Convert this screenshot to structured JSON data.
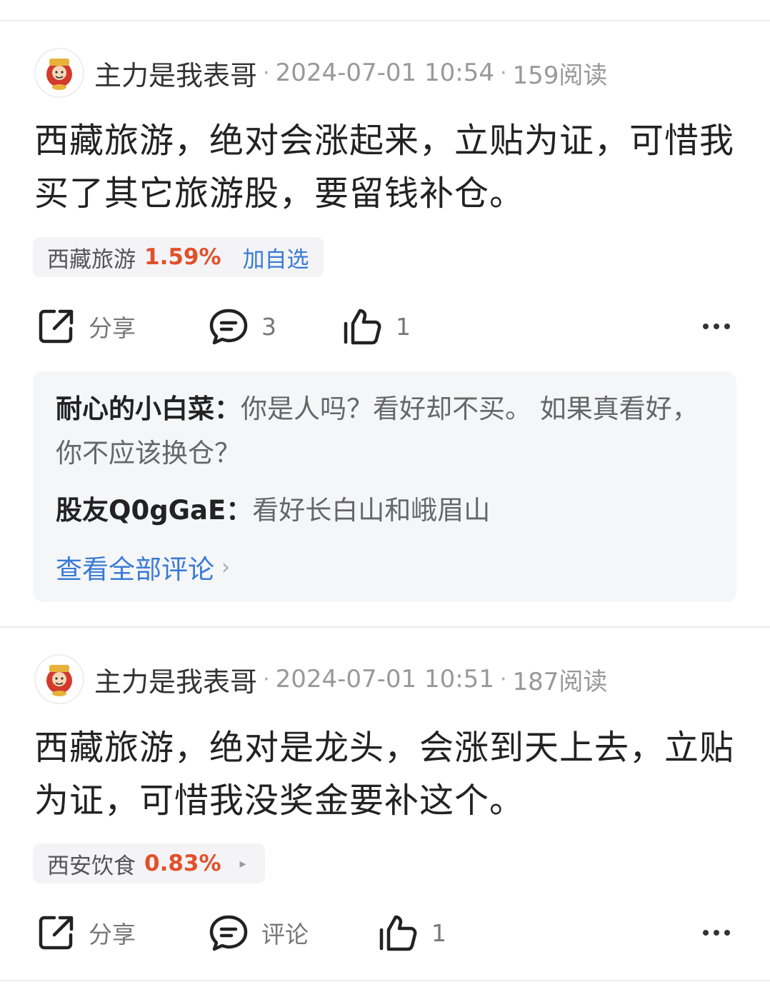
{
  "posts": [
    {
      "author": "主力是我表哥",
      "dot1": "·",
      "datetime": "2024-07-01 10:54",
      "dot2": "·",
      "reads": "159阅读",
      "text": "西藏旅游，绝对会涨起来，立贴为证，可惜我买了其它旅游股，要留钱补仓。",
      "stock": {
        "name": "西藏旅游",
        "change": "1.59%",
        "action": "加自选"
      },
      "actions": {
        "share": "分享",
        "comment": "3",
        "like": "1"
      },
      "comments": [
        {
          "name": "耐心的小白菜：",
          "text": "你是人吗？看好却不买。 如果真看好，你不应该换仓？"
        },
        {
          "name": "股友Q0gGaE：",
          "text": "看好长白山和峨眉山"
        }
      ],
      "view_all": "查看全部评论",
      "view_all_chevron": "›"
    },
    {
      "author": "主力是我表哥",
      "dot1": "·",
      "datetime": "2024-07-01 10:51",
      "dot2": "·",
      "reads": "187阅读",
      "text": "西藏旅游，绝对是龙头，会涨到天上去，立贴为证，可惜我没奖金要补这个。",
      "stock": {
        "name": "西安饮食",
        "change": "0.83%",
        "arrow": "▸"
      },
      "actions": {
        "share": "分享",
        "comment": "评论",
        "like": "1"
      }
    }
  ],
  "colors": {
    "up": "#e2502a",
    "link": "#3a7bd5",
    "panel": "#f5f6f8"
  },
  "icons": [
    "avatar-god-of-wealth-icon",
    "share-icon",
    "comment-icon",
    "like-icon",
    "more-icon"
  ]
}
